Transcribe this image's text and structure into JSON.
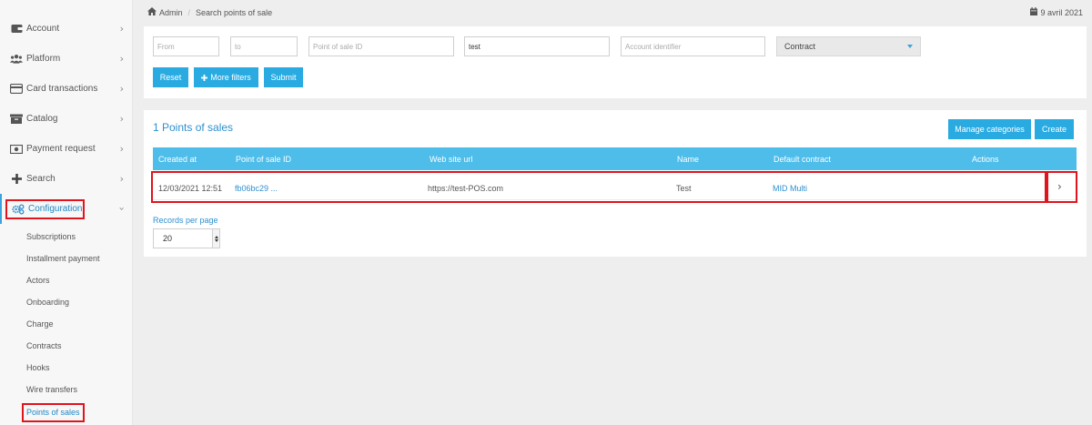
{
  "sidebar": {
    "items": [
      {
        "label": "Account",
        "icon": "wallet-icon"
      },
      {
        "label": "Platform",
        "icon": "users-icon"
      },
      {
        "label": "Card transactions",
        "icon": "credit-card-icon"
      },
      {
        "label": "Catalog",
        "icon": "archive-icon"
      },
      {
        "label": "Payment request",
        "icon": "money-bill-icon"
      },
      {
        "label": "Search",
        "icon": "plus-icon"
      },
      {
        "label": "Configuration",
        "icon": "cogs-icon"
      }
    ],
    "sub_items": [
      "Subscriptions",
      "Installment payment",
      "Actors",
      "Onboarding",
      "Charge",
      "Contracts",
      "Hooks",
      "Wire transfers",
      "Points of sales"
    ]
  },
  "breadcrumb": {
    "root": "Admin",
    "current": "Search points of sale"
  },
  "date": "9 avril 2021",
  "filters": {
    "from_placeholder": "From",
    "to_placeholder": "to",
    "pos_id_placeholder": "Point of sale ID",
    "name_value": "test",
    "account_placeholder": "Account identifier",
    "contract_select": "Contract",
    "reset_label": "Reset",
    "more_filters_label": "More filters",
    "submit_label": "Submit"
  },
  "results": {
    "title": "1 Points of sales",
    "manage_categories_label": "Manage categories",
    "create_label": "Create",
    "columns": [
      "Created at",
      "Point of sale ID",
      "Web site url",
      "Name",
      "Default contract",
      "Actions"
    ],
    "rows": [
      {
        "created_at": "12/03/2021 12:51",
        "pos_id": "fb06bc29 ...",
        "url": "https://test-POS.com",
        "name": "Test",
        "contract": "MID Multi"
      }
    ],
    "records_per_page_label": "Records per page",
    "records_per_page_value": "20"
  },
  "colors": {
    "accent": "#29abe2",
    "link": "#2e8fd0",
    "highlight": "#e0141c"
  }
}
